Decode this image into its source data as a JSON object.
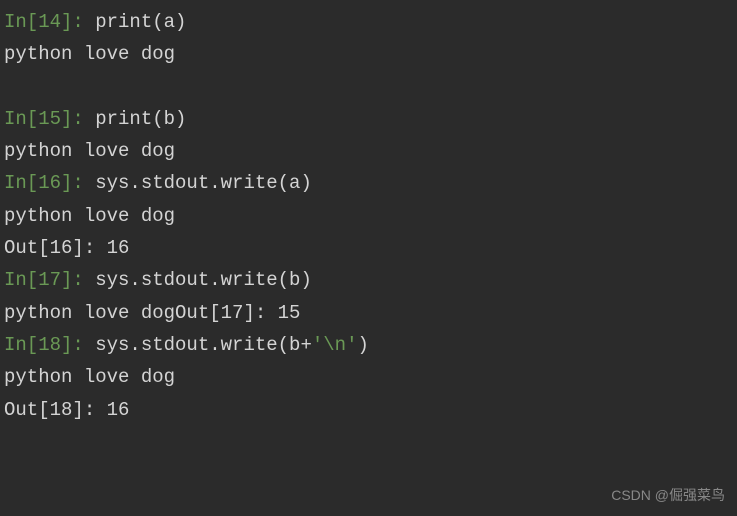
{
  "cells": {
    "c14": {
      "in_prompt": "In[14]: ",
      "code": "print(a)",
      "output": "python love dog"
    },
    "c15": {
      "in_prompt": "In[15]: ",
      "code": "print(b)",
      "output": "python love dog"
    },
    "c16": {
      "in_prompt": "In[16]: ",
      "code": "sys.stdout.write(a)",
      "output": "python love dog",
      "out_prompt": "Out[16]: ",
      "out_value": "16"
    },
    "c17": {
      "in_prompt": "In[17]: ",
      "code": "sys.stdout.write(b)",
      "output_inline": "python love dog",
      "out_prompt_inline": "Out[17]: ",
      "out_value_inline": "15"
    },
    "c18": {
      "in_prompt": "In[18]: ",
      "code_pre": "sys.stdout.write(b+",
      "code_str": "'\\n'",
      "code_post": ")",
      "output": "python love dog",
      "out_prompt": "Out[18]: ",
      "out_value": "16"
    }
  },
  "watermark": "CSDN @倔强菜鸟"
}
